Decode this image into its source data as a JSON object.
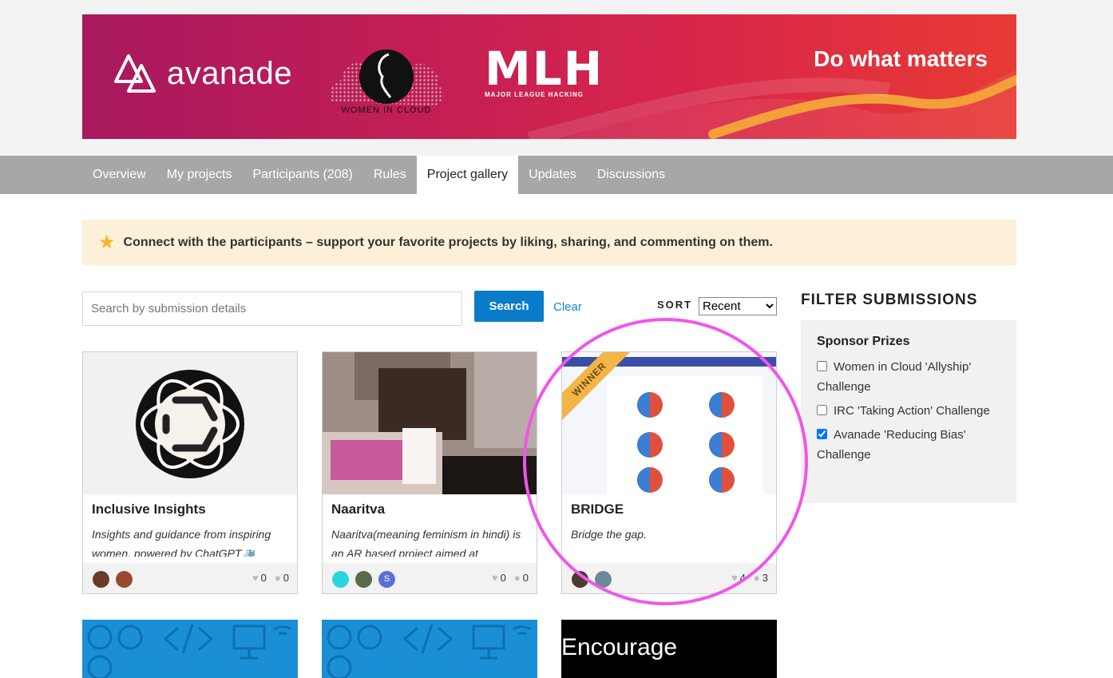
{
  "banner": {
    "brand": "avanade",
    "partner_label": "WOMEN IN CLOUD",
    "mlh_big": "MLH",
    "mlh_small": "MAJOR LEAGUE HACKING",
    "tagline": "Do what matters"
  },
  "nav": {
    "items": [
      {
        "label": "Overview"
      },
      {
        "label": "My projects"
      },
      {
        "label": "Participants (208)"
      },
      {
        "label": "Rules"
      },
      {
        "label": "Project gallery",
        "active": true
      },
      {
        "label": "Updates"
      },
      {
        "label": "Discussions"
      }
    ]
  },
  "notice": {
    "text": "Connect with the participants – support your favorite projects by liking, sharing, and commenting on them."
  },
  "search": {
    "placeholder": "Search by submission details",
    "button": "Search",
    "clear": "Clear"
  },
  "sort": {
    "label": "SORT",
    "selected": "Recent"
  },
  "filter": {
    "title": "FILTER SUBMISSIONS",
    "group": "Sponsor Prizes",
    "options": [
      {
        "label": "Women in Cloud 'Allyship' Challenge",
        "checked": false
      },
      {
        "label": "IRC 'Taking Action' Challenge",
        "checked": false
      },
      {
        "label": "Avanade 'Reducing Bias' Challenge",
        "checked": true
      }
    ]
  },
  "projects": [
    {
      "title": "Inclusive Insights",
      "desc": "Insights and guidance from inspiring women, powered by ChatGPT🛳️",
      "likes": "0",
      "comments": "0"
    },
    {
      "title": "Naaritva",
      "desc": "Naaritva(meaning feminism in hindi) is an AR based project aimed at",
      "likes": "0",
      "comments": "0",
      "avatar_letter": "S"
    },
    {
      "title": "BRIDGE",
      "desc": "Bridge the gap.",
      "likes": "4",
      "comments": "3",
      "badge": "WINNER"
    }
  ],
  "bottom_cards": [
    {
      "thumb_text": ""
    },
    {
      "thumb_text": ""
    },
    {
      "thumb_text": "Encourage"
    }
  ],
  "icons": {
    "star": "star-icon",
    "heart": "heart-icon",
    "comment": "comment-icon"
  }
}
